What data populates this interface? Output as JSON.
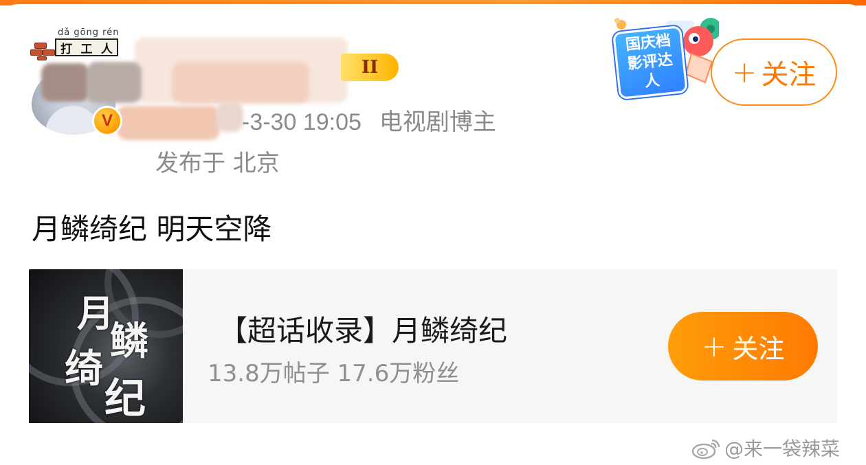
{
  "pendant": {
    "pinyin": "dǎ gōng rén",
    "chars": [
      "打",
      "工",
      "人"
    ]
  },
  "author": {
    "level_badge": "II",
    "datetime_fragment": "-3-30 19:05",
    "datetime_partial": "9",
    "role": "电视剧博主",
    "location": "发布于 北京"
  },
  "sticker": {
    "title_line1": "国庆档",
    "title_line2": "影评达人"
  },
  "follow_button": {
    "plus": "+",
    "label": "关注"
  },
  "post": {
    "text": "月鳞绮纪 明天空降"
  },
  "supertopic": {
    "title": "【超话收录】月鳞绮纪",
    "stats": "13.8万帖子 17.6万粉丝",
    "cover_chars": [
      "月",
      "鳞",
      "绮",
      "纪"
    ],
    "follow_plus": "+",
    "follow_label": "关注"
  },
  "watermark": {
    "text": "@来一袋辣菜"
  },
  "colors": {
    "accent": "#ff7a00",
    "text_primary": "#111111",
    "text_secondary": "#8a8a8a",
    "card_bg": "#f6f6f6"
  },
  "icons": [
    "weibo-logo-icon",
    "verified-v-icon",
    "plus-icon"
  ]
}
